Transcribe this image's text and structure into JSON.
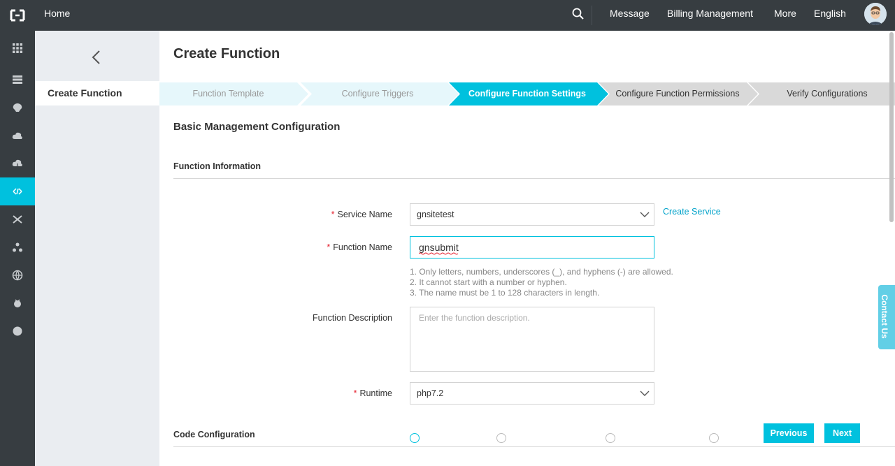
{
  "topbar": {
    "home": "Home",
    "nav": [
      "Message",
      "Billing Management",
      "More",
      "English"
    ]
  },
  "rail": {
    "icons": [
      "grid-icon",
      "server-icon",
      "brain-icon",
      "cloud-upload-icon",
      "cloud-download-icon",
      "function-compute-icon",
      "shuffle-icon",
      "cluster-icon",
      "globe-icon",
      "bug-icon",
      "circle-icon"
    ],
    "active_index": 5
  },
  "sidebar": {
    "item": "Create Function"
  },
  "page": {
    "title": "Create Function"
  },
  "steps": [
    {
      "label": "Function Template",
      "state": "done"
    },
    {
      "label": "Configure Triggers",
      "state": "done"
    },
    {
      "label": "Configure Function Settings",
      "state": "active"
    },
    {
      "label": "Configure Function Permissions",
      "state": "todo"
    },
    {
      "label": "Verify Configurations",
      "state": "todo"
    }
  ],
  "form": {
    "section_title": "Basic Management Configuration",
    "function_info_title": "Function Information",
    "service_name": {
      "label": "Service Name",
      "value": "gnsitetest",
      "link": "Create Service"
    },
    "function_name": {
      "label": "Function Name",
      "value": "gnsubmit",
      "hints": [
        "1. Only letters, numbers, underscores (_), and hyphens (-) are allowed.",
        "2. It cannot start with a number or hyphen.",
        "3. The name must be 1 to 128 characters in length."
      ]
    },
    "description": {
      "label": "Function Description",
      "placeholder": "Enter the function description."
    },
    "runtime": {
      "label": "Runtime",
      "value": "php7.2"
    },
    "code_config_title": "Code Configuration"
  },
  "buttons": {
    "previous": "Previous",
    "next": "Next"
  },
  "contact": "Contact Us",
  "colors": {
    "topbar": "#373d41",
    "accent": "#00c1de",
    "step_done": "#e6f7fb",
    "step_todo": "#d9d9d9"
  }
}
